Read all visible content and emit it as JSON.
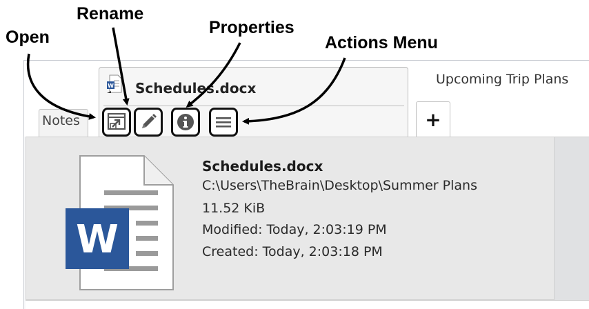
{
  "callouts": {
    "open": "Open",
    "rename": "Rename",
    "properties": "Properties",
    "actions_menu": "Actions Menu"
  },
  "tabs": {
    "notes_label": "Notes",
    "file_tab_label": "Schedules.docx",
    "other_tab_label": "Upcoming Trip Plans",
    "add_tab_label": "+"
  },
  "toolbar": {
    "open_icon": "open-external-icon",
    "rename_icon": "pencil-icon",
    "properties_icon": "info-icon",
    "actions_icon": "hamburger-menu-icon"
  },
  "file_info": {
    "name": "Schedules.docx",
    "path": "C:\\Users\\TheBrain\\Desktop\\Summer Plans",
    "size": "11.52 KiB",
    "modified": "Modified: Today, 2:03:19 PM",
    "created": "Created: Today, 2:03:18 PM",
    "icon_letter": "W"
  },
  "colors": {
    "word_blue": "#2b579a",
    "word_blue_dark": "#1e4a8c",
    "panel_gray": "#e8e8e8",
    "icon_dark": "#555555"
  }
}
